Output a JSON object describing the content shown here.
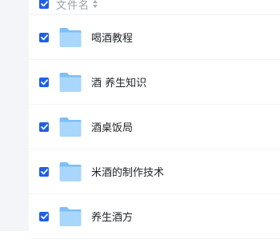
{
  "file_list": {
    "header": {
      "checkbox_checked": true,
      "column_name_label": "文件名",
      "sort_icon": "sort-icon"
    },
    "items": [
      {
        "name": "喝酒教程",
        "type": "folder",
        "icon": "folder-icon",
        "checked": true
      },
      {
        "name": "酒 养生知识",
        "type": "folder",
        "icon": "folder-icon",
        "checked": true
      },
      {
        "name": "酒桌饭局",
        "type": "folder",
        "icon": "folder-icon",
        "checked": true
      },
      {
        "name": "米酒的制作技术",
        "type": "folder",
        "icon": "folder-icon",
        "checked": true
      },
      {
        "name": "养生酒方",
        "type": "folder",
        "icon": "folder-icon",
        "checked": true
      }
    ]
  },
  "colors": {
    "checkbox_accent": "#1f5fe8",
    "folder_light": "#a9d7fb",
    "folder_dark": "#7cc0f6",
    "text": "#1f2329",
    "header_text": "#9aa0a8",
    "side_background": "#f3f5f9"
  }
}
